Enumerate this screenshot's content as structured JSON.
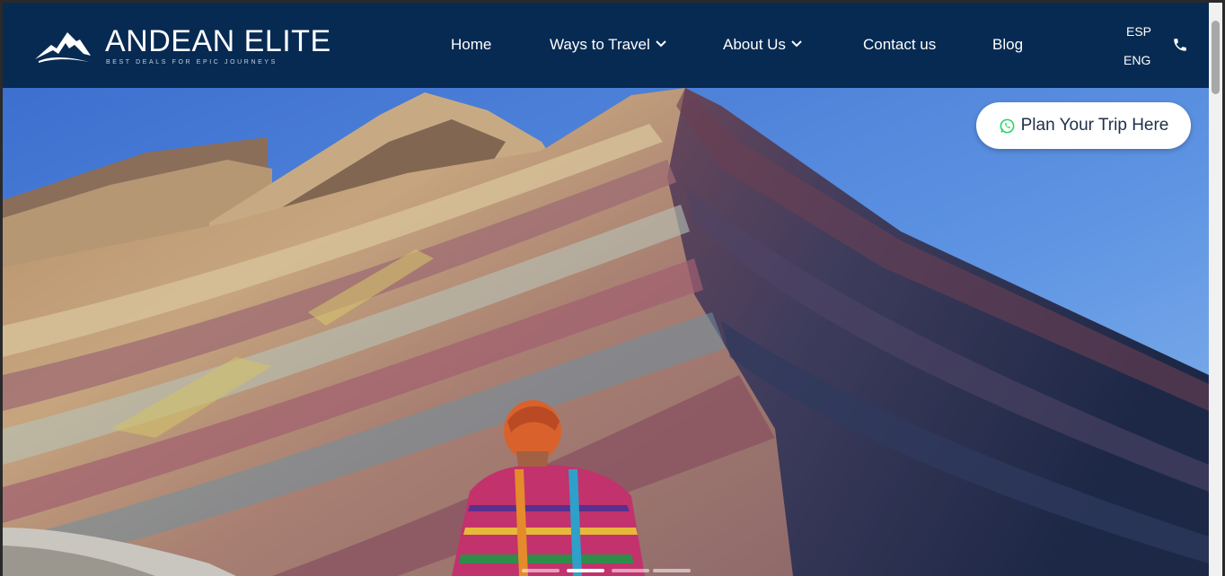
{
  "brand": {
    "name": "ANDEAN ELITE",
    "tagline": "BEST DEALS FOR EPIC JOURNEYS",
    "logo_icon": "mountain-peak-icon"
  },
  "nav": {
    "items": [
      {
        "label": "Home",
        "has_dropdown": false
      },
      {
        "label": "Ways to Travel",
        "has_dropdown": true
      },
      {
        "label": "About Us",
        "has_dropdown": true
      },
      {
        "label": "Contact us",
        "has_dropdown": false
      },
      {
        "label": "Blog",
        "has_dropdown": false
      }
    ],
    "languages": [
      "ESP",
      "ENG"
    ],
    "phone_icon": "phone-icon"
  },
  "hero": {
    "cta_label": "Plan Your Trip Here",
    "cta_icon": "whatsapp-icon",
    "slides_count": 4,
    "active_slide": 2
  },
  "colors": {
    "header_bg": "#072a52",
    "cta_bg": "#ffffff",
    "whatsapp_green": "#25d366"
  }
}
